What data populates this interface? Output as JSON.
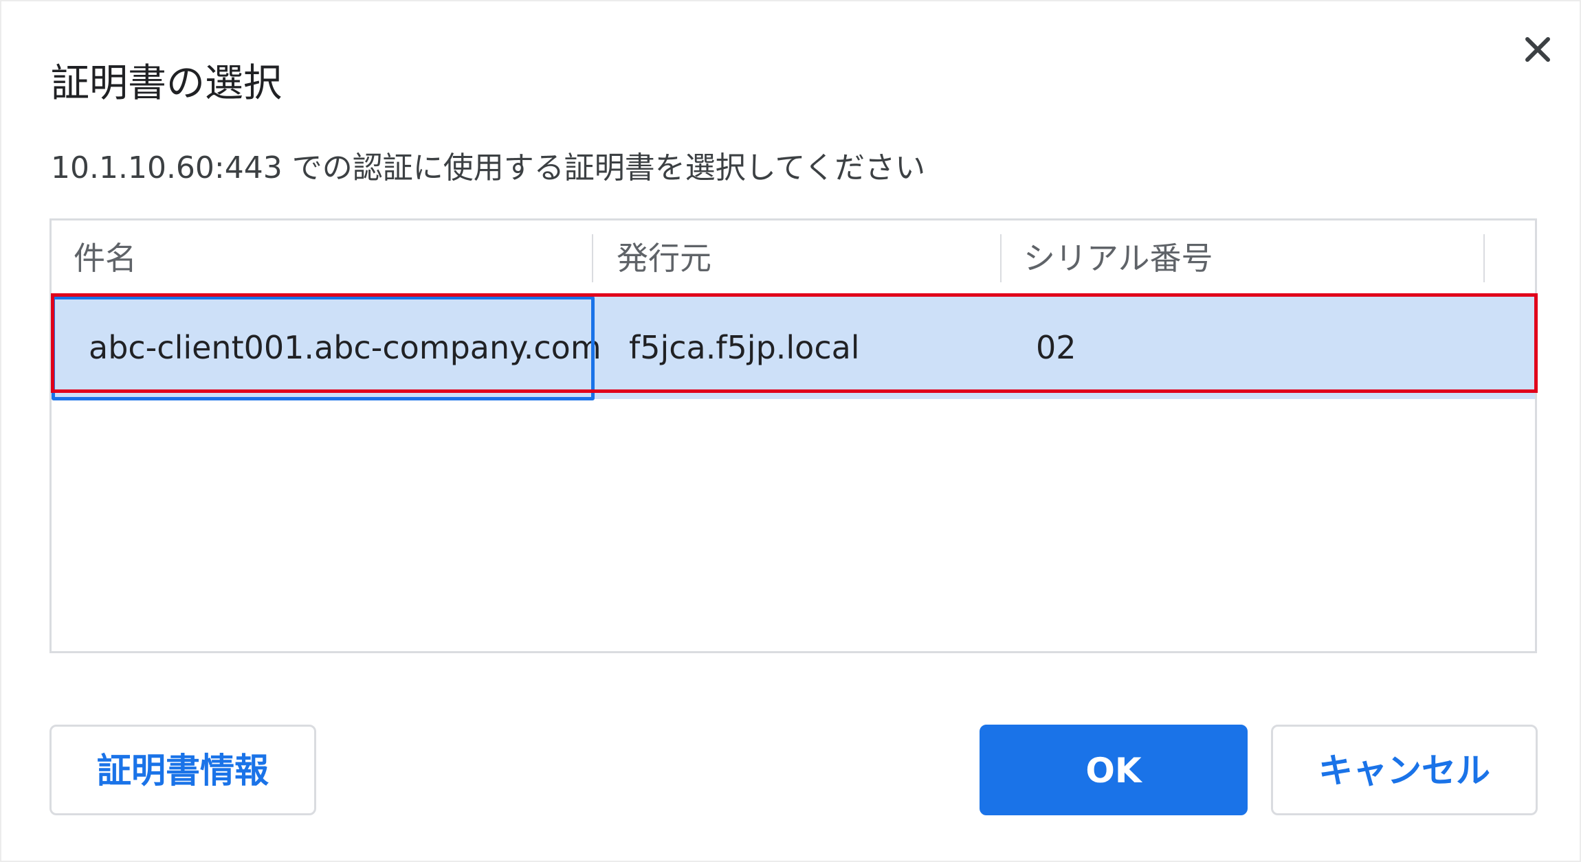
{
  "dialog": {
    "title": "証明書の選択",
    "subtitle": "10.1.10.60:443 での認証に使用する証明書を選択してください",
    "close_icon": "close-icon"
  },
  "table": {
    "columns": [
      "件名",
      "発行元",
      "シリアル番号"
    ],
    "rows": [
      {
        "subject": "abc-client001.abc-company.com",
        "issuer": "f5jca.f5jp.local",
        "serial": "02",
        "selected": true
      }
    ]
  },
  "buttons": {
    "cert_info": "証明書情報",
    "ok": "OK",
    "cancel": "キャンセル"
  },
  "colors": {
    "accent": "#1a73e8",
    "selected_row": "#cde0f8",
    "highlight": "#e0001b"
  }
}
